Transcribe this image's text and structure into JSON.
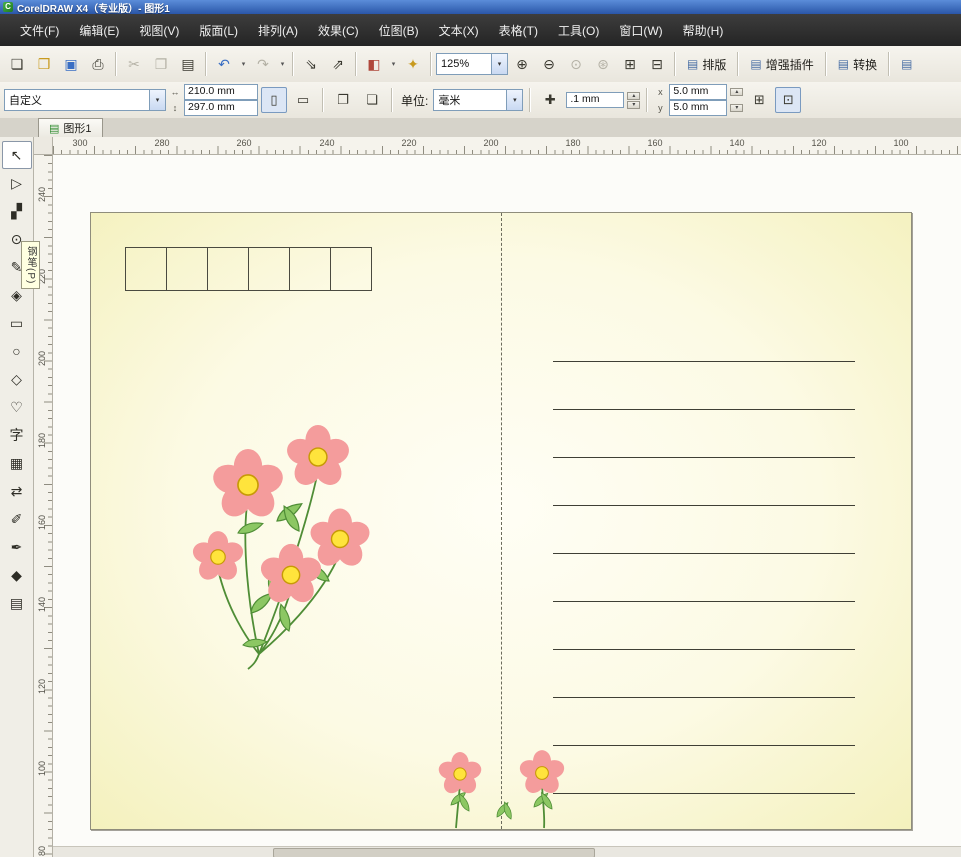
{
  "window": {
    "title": "CorelDRAW X4（专业版）- 图形1"
  },
  "menu": {
    "items": [
      "文件(F)",
      "编辑(E)",
      "视图(V)",
      "版面(L)",
      "排列(A)",
      "效果(C)",
      "位图(B)",
      "文本(X)",
      "表格(T)",
      "工具(O)",
      "窗口(W)",
      "帮助(H)"
    ]
  },
  "standard_toolbar": {
    "zoom_level": "125%",
    "layout_label": "排版",
    "plugins_label": "增强插件",
    "convert_label": "转换"
  },
  "property_bar": {
    "preset": "自定义",
    "paper_width": "210.0 mm",
    "paper_height": "297.0 mm",
    "units_label": "单位:",
    "units_value": "毫米",
    "nudge_offset": ".1 mm",
    "duplicate_x": "5.0 mm",
    "duplicate_y": "5.0 mm"
  },
  "document": {
    "tab_label": "图形1"
  },
  "rulers": {
    "horizontal": [
      "300",
      "280",
      "260",
      "240",
      "220",
      "200",
      "180",
      "160",
      "140",
      "120",
      "100"
    ],
    "vertical": [
      "240",
      "220",
      "200",
      "180",
      "160",
      "140",
      "120",
      "100",
      "80"
    ]
  },
  "toolbox": {
    "tooltip": "钢笔(P)"
  },
  "icons": {
    "app": "C",
    "dropdown": "▾",
    "new": "❏",
    "open": "❒",
    "save": "▣",
    "print": "⎙",
    "cut": "✂",
    "copy": "❐",
    "paste": "▤",
    "undo": "↶",
    "redo": "↷",
    "import": "⇘",
    "export": "⇗",
    "launcher": "◧",
    "welcome": "✦",
    "zoom_in": "⊕",
    "zoom_out": "⊖",
    "zoom_actual": "⊙",
    "zoom_selected": "⊛",
    "zoom_page": "⊞",
    "zoom_width": "⊟",
    "toolbar_btn": "▤",
    "width": "↔",
    "height": "↕",
    "portrait": "▯",
    "landscape": "▭",
    "pages_all": "❐",
    "pages_one": "❏",
    "nudge": "✚",
    "spin_up": "▴",
    "spin_down": "▾",
    "dup_x": "x",
    "dup_y": "y",
    "snap": "⊞",
    "options": "⊡",
    "doc": "▤",
    "pick": "↖",
    "shape": "▷",
    "crop": "▞",
    "zoom_tool": "⊙",
    "freehand": "✎",
    "smart_fill": "◈",
    "rectangle": "▭",
    "ellipse": "○",
    "polygon": "◇",
    "shapes": "♡",
    "text_tool": "字",
    "table": "▦",
    "interactive": "⇄",
    "eyedropper": "✐",
    "outline": "✒",
    "fill": "◆",
    "interactive_fill": "▤"
  },
  "colors": {
    "titlebar": "#2a56a8",
    "menubar": "#2e2e2e",
    "toolbar_bg": "#f0eee7",
    "card_yellow": "#f4f1bd",
    "petal_pink": "#f49c9c",
    "flower_center": "#ffe43c",
    "leaf_green": "#8cc763",
    "stem_green": "#4f8d36"
  }
}
